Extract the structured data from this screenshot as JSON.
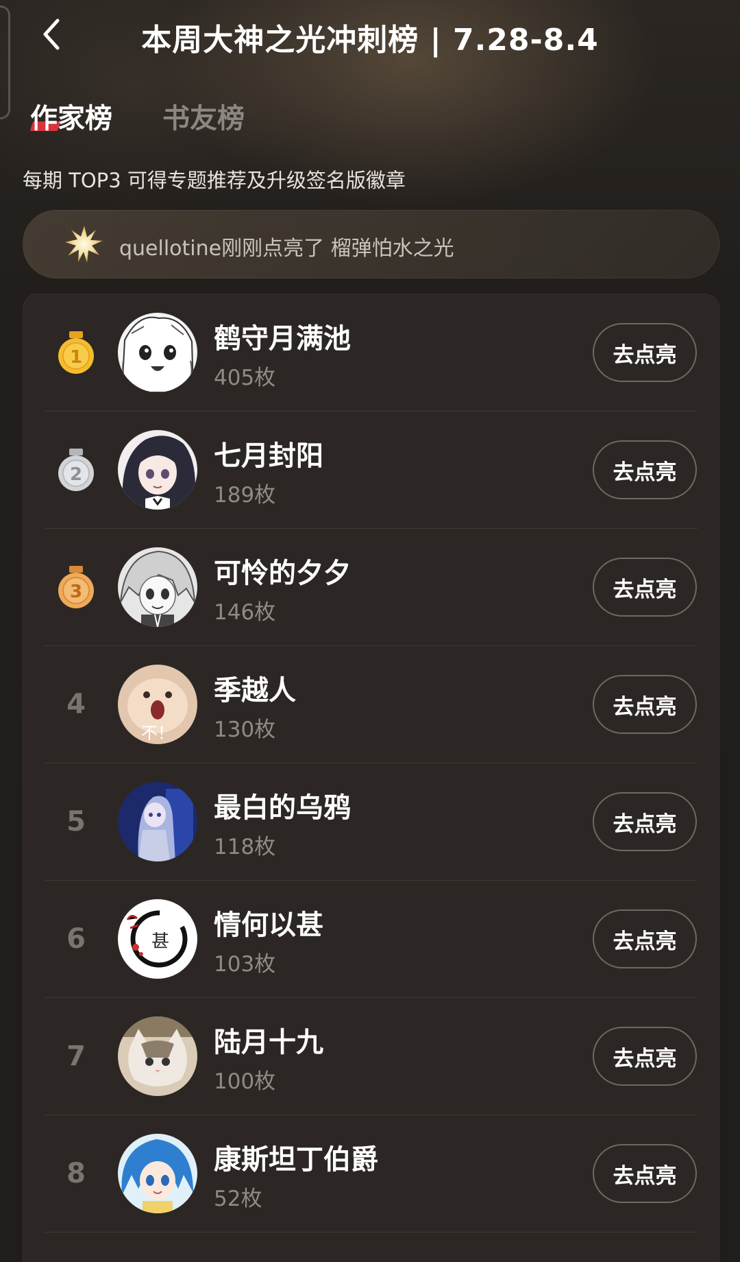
{
  "header": {
    "title": "本周大神之光冲刺榜 | 7.28-8.4"
  },
  "tabs": [
    {
      "label": "作家榜",
      "active": true
    },
    {
      "label": "书友榜",
      "active": false
    }
  ],
  "subtitle": "每期 TOP3 可得专题推荐及升级签名版徽章",
  "ticker": {
    "text": "quellotine刚刚点亮了 榴弹怕水之光",
    "icon": "sparkle-badge-icon"
  },
  "ranking": [
    {
      "rank": "1",
      "medal": "gold-medal-icon",
      "name": "鹤守月满池",
      "count": "405枚",
      "button": "去点亮"
    },
    {
      "rank": "2",
      "medal": "silver-medal-icon",
      "name": "七月封阳",
      "count": "189枚",
      "button": "去点亮"
    },
    {
      "rank": "3",
      "medal": "bronze-medal-icon",
      "name": "可怜的夕夕",
      "count": "146枚",
      "button": "去点亮"
    },
    {
      "rank": "4",
      "name": "季越人",
      "count": "130枚",
      "button": "去点亮",
      "avatar_caption": "不！"
    },
    {
      "rank": "5",
      "name": "最白的乌鸦",
      "count": "118枚",
      "button": "去点亮"
    },
    {
      "rank": "6",
      "name": "情何以甚",
      "count": "103枚",
      "button": "去点亮",
      "avatar_caption": "甚"
    },
    {
      "rank": "7",
      "name": "陆月十九",
      "count": "100枚",
      "button": "去点亮"
    },
    {
      "rank": "8",
      "name": "康斯坦丁伯爵",
      "count": "52枚",
      "button": "去点亮"
    }
  ],
  "colors": {
    "background": "#201d1b",
    "card": "#2c2724",
    "accent_red": "#d8343b",
    "gold": "#f3b62a",
    "silver": "#c7c8cc",
    "bronze": "#e9a04f"
  }
}
